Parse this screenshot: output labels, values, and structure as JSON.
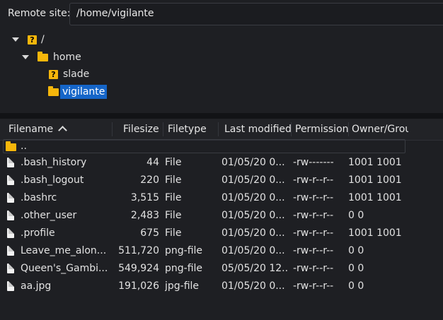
{
  "remote": {
    "label": "Remote site:",
    "path": "/home/vigilante"
  },
  "tree": {
    "root": "/",
    "home": "home",
    "children": [
      "slade",
      "vigilante"
    ],
    "selected": "vigilante"
  },
  "columns": {
    "filename": "Filename",
    "filesize": "Filesize",
    "filetype": "Filetype",
    "last_modified": "Last modified",
    "permission": "Permission",
    "owner_group": "Owner/Grou"
  },
  "parent_dir": "..",
  "files": [
    {
      "name": ".bash_history",
      "size": "44",
      "type": "File",
      "modified": "01/05/20 0...",
      "perm": "-rw-------",
      "owner": "1001 1001"
    },
    {
      "name": ".bash_logout",
      "size": "220",
      "type": "File",
      "modified": "01/05/20 0...",
      "perm": "-rw-r--r--",
      "owner": "1001 1001"
    },
    {
      "name": ".bashrc",
      "size": "3,515",
      "type": "File",
      "modified": "01/05/20 0...",
      "perm": "-rw-r--r--",
      "owner": "1001 1001"
    },
    {
      "name": ".other_user",
      "size": "2,483",
      "type": "File",
      "modified": "01/05/20 0...",
      "perm": "-rw-r--r--",
      "owner": "0 0"
    },
    {
      "name": ".profile",
      "size": "675",
      "type": "File",
      "modified": "01/05/20 0...",
      "perm": "-rw-r--r--",
      "owner": "1001 1001"
    },
    {
      "name": "Leave_me_alon...",
      "size": "511,720",
      "type": "png-file",
      "modified": "01/05/20 0...",
      "perm": "-rw-r--r--",
      "owner": "0 0"
    },
    {
      "name": "Queen's_Gambi...",
      "size": "549,924",
      "type": "png-file",
      "modified": "05/05/20 12...",
      "perm": "-rw-r--r--",
      "owner": "0 0"
    },
    {
      "name": "aa.jpg",
      "size": "191,026",
      "type": "jpg-file",
      "modified": "01/05/20 0...",
      "perm": "-rw-r--r--",
      "owner": "0 0"
    }
  ]
}
